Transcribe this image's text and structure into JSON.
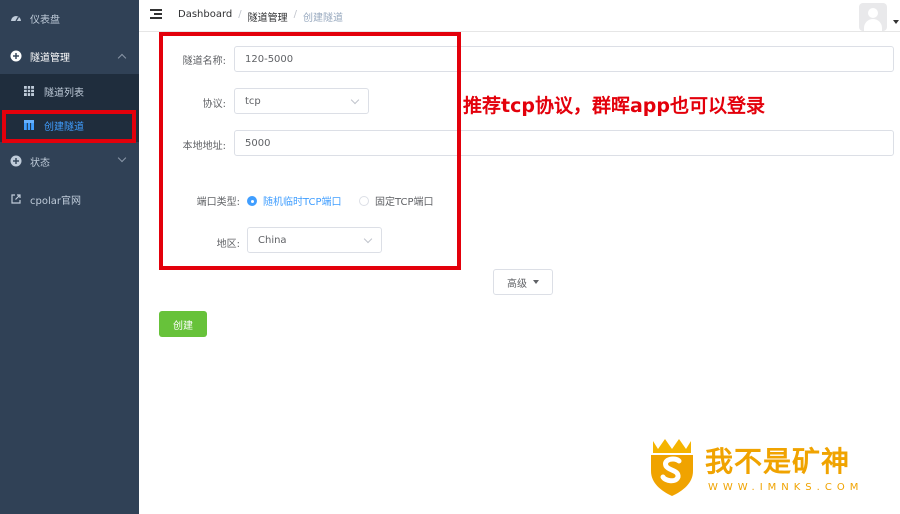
{
  "sidebar": {
    "dashboard": "仪表盘",
    "tunnel_mgmt": "隧道管理",
    "tunnel_list": "隧道列表",
    "create_tunnel": "创建隧道",
    "status": "状态",
    "cpolar_site": "cpolar官网"
  },
  "header": {
    "breadcrumb": [
      "Dashboard",
      "隧道管理",
      "创建隧道"
    ]
  },
  "form": {
    "name_label": "隧道名称:",
    "name_value": "120-5000",
    "protocol_label": "协议:",
    "protocol_value": "tcp",
    "local_label": "本地地址:",
    "local_value": "5000",
    "port_type_label": "端口类型:",
    "port_type_options": [
      "随机临时TCP端口",
      "固定TCP端口"
    ],
    "region_label": "地区:",
    "region_value": "China",
    "advanced_label": "高级",
    "create_label": "创建"
  },
  "annotation": {
    "text": "推荐tcp协议，群晖app也可以登录",
    "color": "#e3000b"
  },
  "watermark": {
    "title": "我不是矿神",
    "url": "WWW.IMNKS.COM",
    "color": "#f0a300"
  },
  "colors": {
    "sidebar_bg": "#304156",
    "active": "#409eff",
    "create_button": "#67c23a"
  }
}
